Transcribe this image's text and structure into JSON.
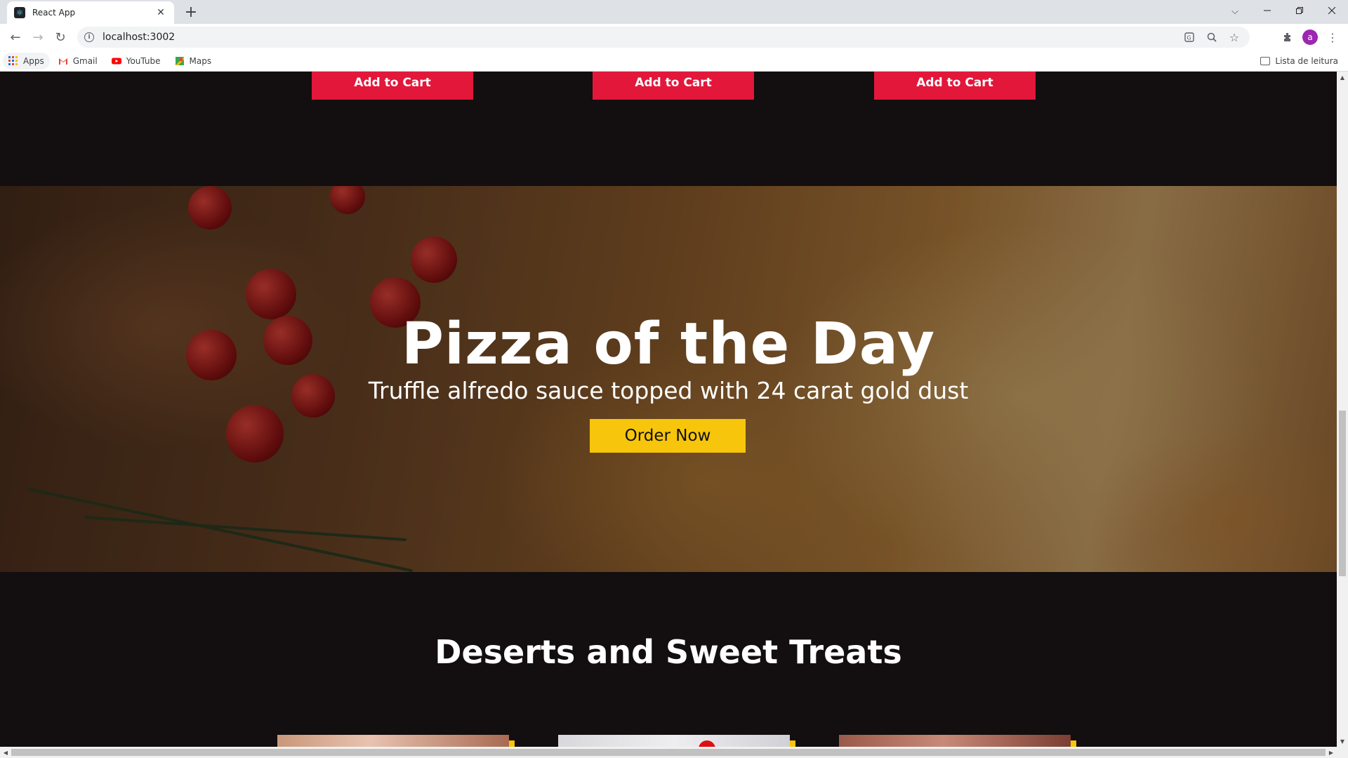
{
  "browser": {
    "tab_title": "React App",
    "tab_close": "✕",
    "new_tab": "+",
    "url": "localhost:3002",
    "profile_initial": "a",
    "bookmarks": [
      {
        "label": "Apps"
      },
      {
        "label": "Gmail"
      },
      {
        "label": "YouTube"
      },
      {
        "label": "Maps"
      }
    ],
    "reading_list": "Lista de leitura"
  },
  "cart_buttons": [
    {
      "label": "Add to Cart"
    },
    {
      "label": "Add to Cart"
    },
    {
      "label": "Add to Cart"
    }
  ],
  "hero": {
    "title": "Pizza of the Day",
    "subtitle": "Truffle alfredo sauce topped with 24 carat gold dust",
    "cta": "Order Now"
  },
  "section": {
    "title": "Deserts and Sweet Treats"
  },
  "colors": {
    "page_bg": "#130e0f",
    "cart_button": "#e2173a",
    "cta_button": "#f7c50b"
  }
}
